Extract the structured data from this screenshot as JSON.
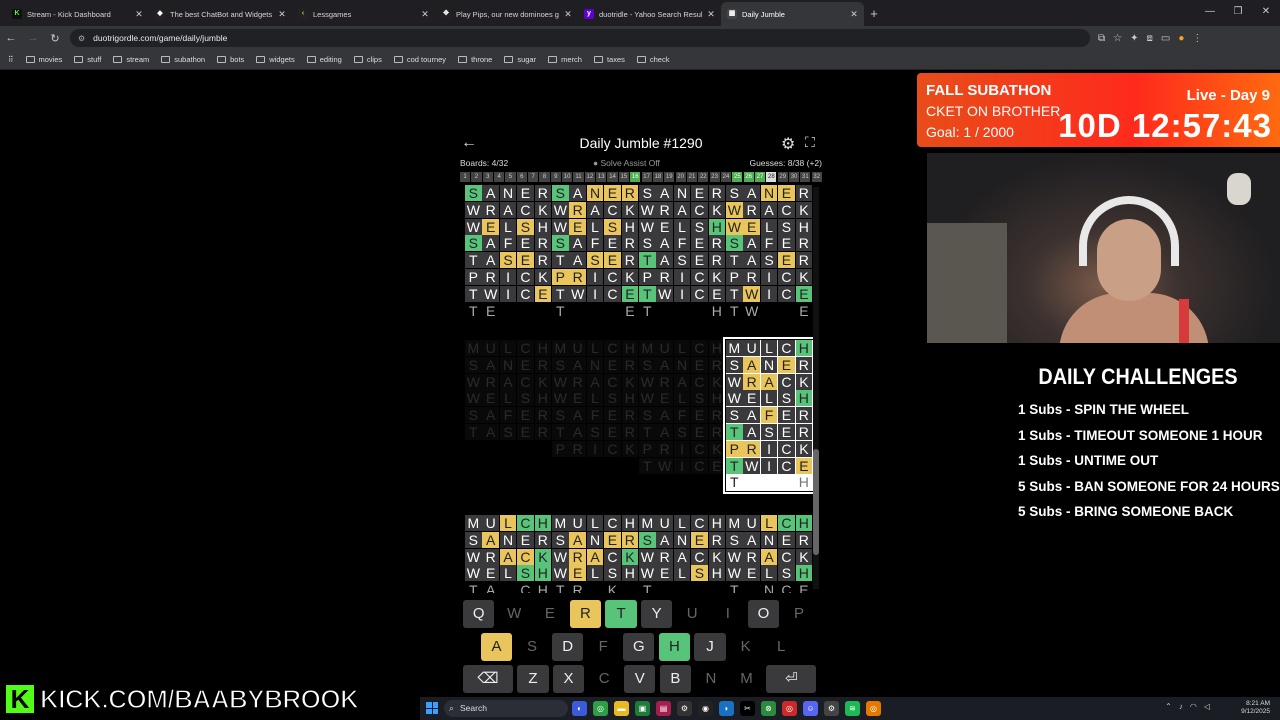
{
  "browser": {
    "tabs": [
      {
        "title": "Stream - Kick Dashboard",
        "fav_color": "#0f0f0f",
        "fav_text": "K",
        "fav_fg": "#53fc18",
        "active": false
      },
      {
        "title": "The best ChatBot and Widgets",
        "fav_color": "#222",
        "fav_text": "◆",
        "fav_fg": "#fff",
        "active": false
      },
      {
        "title": "Lessgames",
        "fav_color": "#222",
        "fav_text": "‹",
        "fav_fg": "#f4c542",
        "active": false
      },
      {
        "title": "Play Pips, our new dominoes game",
        "fav_color": "#222",
        "fav_text": "✥",
        "fav_fg": "#fff",
        "active": false
      },
      {
        "title": "duotridle - Yahoo Search Results",
        "fav_color": "#5f01d1",
        "fav_text": "y",
        "fav_fg": "#fff",
        "active": false
      },
      {
        "title": "Daily Jumble",
        "fav_color": "#444",
        "fav_text": "▦",
        "fav_fg": "#fff",
        "active": true
      }
    ],
    "new_tab_symbol": "+",
    "url": "duotrigordle.com/game/daily/jumble",
    "bookmarks": [
      "movies",
      "stuff",
      "stream",
      "subathon",
      "bots",
      "widgets",
      "editing",
      "clips",
      "cod tourney",
      "throne",
      "sugar",
      "merch",
      "taxes",
      "check"
    ]
  },
  "game": {
    "title": "Daily Jumble #1290",
    "boards_label": "Boards: 4/32",
    "assist_label": "Solve Assist Off",
    "guesses_label": "Guesses: 8/38 (+2)",
    "board_numbers": [
      "1",
      "2",
      "3",
      "4",
      "5",
      "6",
      "7",
      "8",
      "9",
      "10",
      "11",
      "12",
      "13",
      "14",
      "15",
      "16",
      "17",
      "18",
      "19",
      "20",
      "21",
      "22",
      "23",
      "24",
      "25",
      "26",
      "27",
      "28",
      "29",
      "30",
      "31",
      "32"
    ],
    "solved_numbers": [
      "16",
      "25",
      "26",
      "27"
    ],
    "current_number": "28",
    "boards": [
      {
        "id": "b1",
        "rows": [
          "gSANER",
          "WRACK",
          "WyELySH",
          "gSAFER",
          "TAySyER",
          "PRICK",
          "TWICyE",
          "pTpE"
        ]
      },
      {
        "id": "b2",
        "rows": [
          "gSAyNyEyR",
          "WyRACK",
          "WyELySH",
          "gSAFER",
          "TAySyER",
          "yPyRICK",
          "TWICgE",
          "pT___pE"
        ]
      },
      {
        "id": "b3",
        "rows": [
          "SANER",
          "WRACK",
          "WELSgH",
          "SAFER",
          "gTASER",
          "PRICK",
          "gTWICE",
          "pT___pH"
        ]
      },
      {
        "id": "b4",
        "rows": [
          "SAyNyER",
          "yWRACK",
          "yWyELSH",
          "gSAFER",
          "TASyER",
          "PRICK",
          "TyWICgE",
          "pTpW__pE"
        ]
      },
      {
        "id": "b5",
        "solved": true,
        "rows": [
          "MULCH",
          "SANER",
          "WRACK",
          "WELSH",
          "SAFER",
          "TASER"
        ]
      },
      {
        "id": "b6",
        "solved": true,
        "rows": [
          "MULCH",
          "SANER",
          "WRACK",
          "WELSH",
          "SAFER",
          "TASER",
          "PRICK"
        ]
      },
      {
        "id": "b7",
        "solved": true,
        "rows": [
          "MULCH",
          "SANER",
          "WRACK",
          "WELSH",
          "SAFER",
          "TASER",
          "PRICK",
          "TWICE"
        ]
      },
      {
        "id": "b8",
        "highlight": true,
        "rows": [
          "MULCgH",
          "SyANyER",
          "WyRyACK",
          "WELSgH",
          "SAyFER",
          "gTASER",
          "yPyRICK",
          "gTWICyE",
          "nT___pH"
        ]
      },
      {
        "id": "b9",
        "rows": [
          "MUyLgCgH",
          "SyANER",
          "WRyAyCgK",
          "WELgSgH",
          "pTpA_pCpH"
        ]
      },
      {
        "id": "b10",
        "rows": [
          "MULCH",
          "SyANyEyR",
          "WyRyACgK",
          "WyELSH",
          "pTpR_pK_"
        ]
      },
      {
        "id": "b11",
        "rows": [
          "MULCH",
          "gSANyER",
          "WRACK",
          "WELySH",
          "pT____"
        ]
      },
      {
        "id": "b12",
        "rows": [
          "MUyLgCgH",
          "SANER",
          "WRyACK",
          "WELSgH",
          "pT_pNpCpE"
        ]
      }
    ]
  },
  "keyboard": {
    "rows": [
      [
        {
          "k": "Q",
          "s": "n"
        },
        {
          "k": "W",
          "s": "dark"
        },
        {
          "k": "E",
          "s": "dark"
        },
        {
          "k": "R",
          "s": "y"
        },
        {
          "k": "T",
          "s": "g"
        },
        {
          "k": "Y",
          "s": "n"
        },
        {
          "k": "U",
          "s": "dark"
        },
        {
          "k": "I",
          "s": "dark"
        },
        {
          "k": "O",
          "s": "n"
        },
        {
          "k": "P",
          "s": "dark"
        }
      ],
      [
        {
          "k": "A",
          "s": "y"
        },
        {
          "k": "S",
          "s": "dark"
        },
        {
          "k": "D",
          "s": "n"
        },
        {
          "k": "F",
          "s": "dark"
        },
        {
          "k": "G",
          "s": "n"
        },
        {
          "k": "H",
          "s": "g"
        },
        {
          "k": "J",
          "s": "n"
        },
        {
          "k": "K",
          "s": "dark"
        },
        {
          "k": "L",
          "s": "dark"
        }
      ],
      [
        {
          "k": "⌫",
          "s": "n",
          "wide": true
        },
        {
          "k": "Z",
          "s": "n"
        },
        {
          "k": "X",
          "s": "n"
        },
        {
          "k": "C",
          "s": "dark"
        },
        {
          "k": "V",
          "s": "n"
        },
        {
          "k": "B",
          "s": "n"
        },
        {
          "k": "N",
          "s": "dark"
        },
        {
          "k": "M",
          "s": "dark"
        },
        {
          "k": "⏎",
          "s": "n",
          "wide": true
        }
      ]
    ]
  },
  "overlay": {
    "subathon_title": "FALL SUBATHON",
    "subathon_scroll": "CKET ON BROTHER",
    "subathon_goal": "Goal: 1 / 2000",
    "live_label": "Live - Day 9",
    "timer": "10D 12:57:43",
    "challenges_title": "DAILY CHALLENGES",
    "challenges": [
      "1 Subs - SPIN THE WHEEL",
      "1 Subs - TIMEOUT SOMEONE 1 HOUR",
      "1 Subs - UNTIME OUT",
      "5 Subs - BAN SOMEONE FOR 24 HOURS",
      "5 Subs - BRING SOMEONE BACK"
    ],
    "kick_url": "KICK.COM/BAABYBROOK",
    "kick_k": "K"
  },
  "taskbar": {
    "search_label": "Search",
    "time": "8:21 AM",
    "date": "9/12/2025"
  },
  "colors": {
    "yellow": "#e9c55b",
    "green": "#58c47a",
    "kick_green": "#53fc18",
    "subathon_red": "#ff2a1c"
  }
}
